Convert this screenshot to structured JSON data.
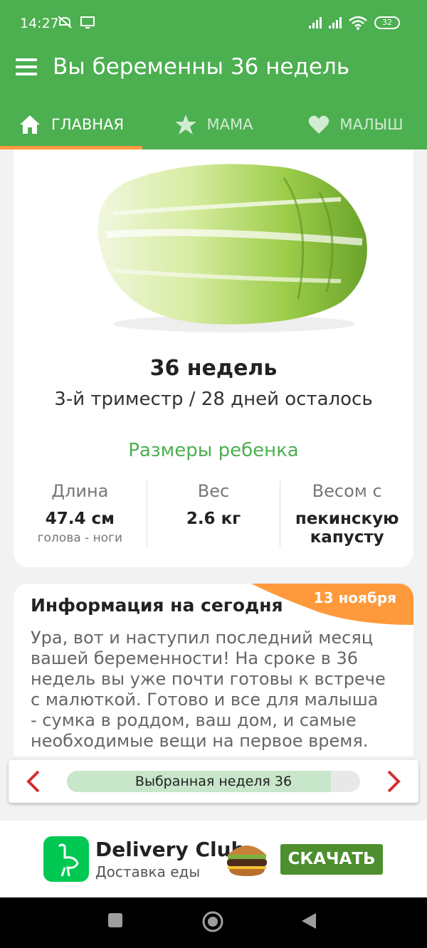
{
  "status_bar": {
    "time": "14:27",
    "battery": "32"
  },
  "app_bar": {
    "title": "Вы беременны 36 недель"
  },
  "tabs": [
    {
      "label": "ГЛАВНАЯ",
      "icon": "home-icon",
      "active": true
    },
    {
      "label": "МАМА",
      "icon": "star-icon",
      "active": false
    },
    {
      "label": "МАЛЫШ",
      "icon": "heart-icon",
      "active": false
    }
  ],
  "week_card": {
    "weeks": "36 недель",
    "trimester": "3-й триместр / 28 дней осталось",
    "sizes_title": "Размеры ребенка",
    "length_label": "Длина",
    "length_value": "47.4 см",
    "length_sub": "голова - ноги",
    "weight_label": "Вес",
    "weight_value": "2.6 кг",
    "compare_label": "Весом с",
    "compare_value": "пекинскую капусту"
  },
  "info": {
    "title": "Информация на сегодня",
    "date": "13 ноября",
    "text": "Ура, вот и наступил последний месяц вашей беременности! На сроке в 36 недель вы уже почти готовы к встрече с малюткой. Готово и все для малыша - сумка в роддом, ваш дом, и самые необходимые вещи на первое время."
  },
  "week_selector": {
    "label": "Выбранная неделя 36",
    "progress": 0.9
  },
  "ad": {
    "brand": "Delivery Club",
    "tagline": "Доставка еды",
    "cta": "СКАЧАТЬ"
  },
  "colors": {
    "primary": "#4caf50",
    "accent": "#ff9a3c",
    "arrow": "#d32f2f"
  }
}
